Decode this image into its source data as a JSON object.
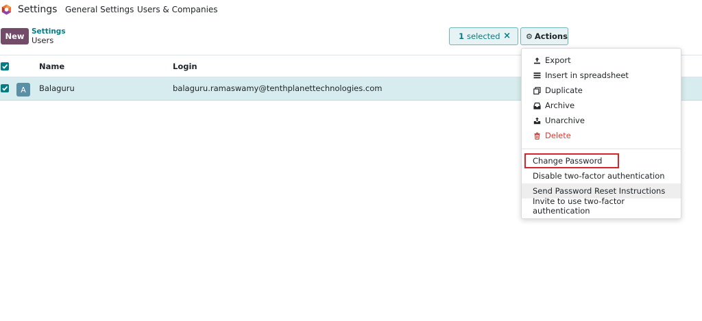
{
  "topnav": {
    "app_title": "Settings",
    "menu": [
      "General Settings",
      "Users & Companies"
    ],
    "logo_icon": "odoo-logo-icon"
  },
  "control_panel": {
    "new_label": "New",
    "breadcrumb_parent": "Settings",
    "breadcrumb_current": "Users",
    "selection_count": "1",
    "selection_text": "selected",
    "clear_selection_icon": "×",
    "actions_label": "Actions"
  },
  "list": {
    "columns": [
      "Name",
      "Login"
    ],
    "rows": [
      {
        "avatar_letter": "A",
        "name": "Balaguru",
        "login": "balaguru.ramaswamy@tenthplanettechnologies.com",
        "selected": true
      }
    ]
  },
  "actions_menu": {
    "items": [
      {
        "label": "Export",
        "icon": "upload-icon"
      },
      {
        "label": "Insert in spreadsheet",
        "icon": "list-icon"
      },
      {
        "label": "Duplicate",
        "icon": "copy-icon"
      },
      {
        "label": "Archive",
        "icon": "inbox-icon"
      },
      {
        "label": "Unarchive",
        "icon": "unarchive-icon"
      },
      {
        "label": "Delete",
        "icon": "trash-icon"
      }
    ],
    "extra_items": [
      "Change Password",
      "Disable two-factor authentication",
      "Send Password Reset Instructions",
      "Invite to use two-factor authentication"
    ]
  },
  "colors": {
    "brand": "#714b67",
    "accent": "#017e84",
    "selected_row": "#d7ecee",
    "danger": "#d23f3a",
    "highlight_box": "#d9232b"
  }
}
